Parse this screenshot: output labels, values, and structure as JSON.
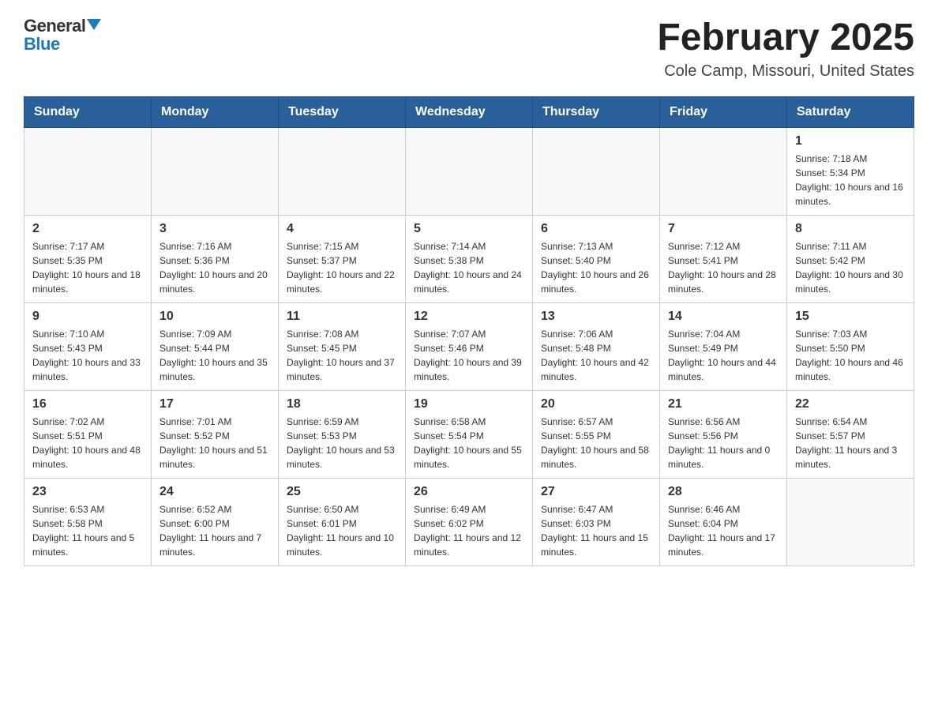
{
  "header": {
    "logo_general": "General",
    "logo_blue": "Blue",
    "month_title": "February 2025",
    "location": "Cole Camp, Missouri, United States"
  },
  "days_of_week": [
    "Sunday",
    "Monday",
    "Tuesday",
    "Wednesday",
    "Thursday",
    "Friday",
    "Saturday"
  ],
  "weeks": [
    [
      {
        "day": "",
        "empty": true
      },
      {
        "day": "",
        "empty": true
      },
      {
        "day": "",
        "empty": true
      },
      {
        "day": "",
        "empty": true
      },
      {
        "day": "",
        "empty": true
      },
      {
        "day": "",
        "empty": true
      },
      {
        "day": "1",
        "sunrise": "Sunrise: 7:18 AM",
        "sunset": "Sunset: 5:34 PM",
        "daylight": "Daylight: 10 hours and 16 minutes."
      }
    ],
    [
      {
        "day": "2",
        "sunrise": "Sunrise: 7:17 AM",
        "sunset": "Sunset: 5:35 PM",
        "daylight": "Daylight: 10 hours and 18 minutes."
      },
      {
        "day": "3",
        "sunrise": "Sunrise: 7:16 AM",
        "sunset": "Sunset: 5:36 PM",
        "daylight": "Daylight: 10 hours and 20 minutes."
      },
      {
        "day": "4",
        "sunrise": "Sunrise: 7:15 AM",
        "sunset": "Sunset: 5:37 PM",
        "daylight": "Daylight: 10 hours and 22 minutes."
      },
      {
        "day": "5",
        "sunrise": "Sunrise: 7:14 AM",
        "sunset": "Sunset: 5:38 PM",
        "daylight": "Daylight: 10 hours and 24 minutes."
      },
      {
        "day": "6",
        "sunrise": "Sunrise: 7:13 AM",
        "sunset": "Sunset: 5:40 PM",
        "daylight": "Daylight: 10 hours and 26 minutes."
      },
      {
        "day": "7",
        "sunrise": "Sunrise: 7:12 AM",
        "sunset": "Sunset: 5:41 PM",
        "daylight": "Daylight: 10 hours and 28 minutes."
      },
      {
        "day": "8",
        "sunrise": "Sunrise: 7:11 AM",
        "sunset": "Sunset: 5:42 PM",
        "daylight": "Daylight: 10 hours and 30 minutes."
      }
    ],
    [
      {
        "day": "9",
        "sunrise": "Sunrise: 7:10 AM",
        "sunset": "Sunset: 5:43 PM",
        "daylight": "Daylight: 10 hours and 33 minutes."
      },
      {
        "day": "10",
        "sunrise": "Sunrise: 7:09 AM",
        "sunset": "Sunset: 5:44 PM",
        "daylight": "Daylight: 10 hours and 35 minutes."
      },
      {
        "day": "11",
        "sunrise": "Sunrise: 7:08 AM",
        "sunset": "Sunset: 5:45 PM",
        "daylight": "Daylight: 10 hours and 37 minutes."
      },
      {
        "day": "12",
        "sunrise": "Sunrise: 7:07 AM",
        "sunset": "Sunset: 5:46 PM",
        "daylight": "Daylight: 10 hours and 39 minutes."
      },
      {
        "day": "13",
        "sunrise": "Sunrise: 7:06 AM",
        "sunset": "Sunset: 5:48 PM",
        "daylight": "Daylight: 10 hours and 42 minutes."
      },
      {
        "day": "14",
        "sunrise": "Sunrise: 7:04 AM",
        "sunset": "Sunset: 5:49 PM",
        "daylight": "Daylight: 10 hours and 44 minutes."
      },
      {
        "day": "15",
        "sunrise": "Sunrise: 7:03 AM",
        "sunset": "Sunset: 5:50 PM",
        "daylight": "Daylight: 10 hours and 46 minutes."
      }
    ],
    [
      {
        "day": "16",
        "sunrise": "Sunrise: 7:02 AM",
        "sunset": "Sunset: 5:51 PM",
        "daylight": "Daylight: 10 hours and 48 minutes."
      },
      {
        "day": "17",
        "sunrise": "Sunrise: 7:01 AM",
        "sunset": "Sunset: 5:52 PM",
        "daylight": "Daylight: 10 hours and 51 minutes."
      },
      {
        "day": "18",
        "sunrise": "Sunrise: 6:59 AM",
        "sunset": "Sunset: 5:53 PM",
        "daylight": "Daylight: 10 hours and 53 minutes."
      },
      {
        "day": "19",
        "sunrise": "Sunrise: 6:58 AM",
        "sunset": "Sunset: 5:54 PM",
        "daylight": "Daylight: 10 hours and 55 minutes."
      },
      {
        "day": "20",
        "sunrise": "Sunrise: 6:57 AM",
        "sunset": "Sunset: 5:55 PM",
        "daylight": "Daylight: 10 hours and 58 minutes."
      },
      {
        "day": "21",
        "sunrise": "Sunrise: 6:56 AM",
        "sunset": "Sunset: 5:56 PM",
        "daylight": "Daylight: 11 hours and 0 minutes."
      },
      {
        "day": "22",
        "sunrise": "Sunrise: 6:54 AM",
        "sunset": "Sunset: 5:57 PM",
        "daylight": "Daylight: 11 hours and 3 minutes."
      }
    ],
    [
      {
        "day": "23",
        "sunrise": "Sunrise: 6:53 AM",
        "sunset": "Sunset: 5:58 PM",
        "daylight": "Daylight: 11 hours and 5 minutes."
      },
      {
        "day": "24",
        "sunrise": "Sunrise: 6:52 AM",
        "sunset": "Sunset: 6:00 PM",
        "daylight": "Daylight: 11 hours and 7 minutes."
      },
      {
        "day": "25",
        "sunrise": "Sunrise: 6:50 AM",
        "sunset": "Sunset: 6:01 PM",
        "daylight": "Daylight: 11 hours and 10 minutes."
      },
      {
        "day": "26",
        "sunrise": "Sunrise: 6:49 AM",
        "sunset": "Sunset: 6:02 PM",
        "daylight": "Daylight: 11 hours and 12 minutes."
      },
      {
        "day": "27",
        "sunrise": "Sunrise: 6:47 AM",
        "sunset": "Sunset: 6:03 PM",
        "daylight": "Daylight: 11 hours and 15 minutes."
      },
      {
        "day": "28",
        "sunrise": "Sunrise: 6:46 AM",
        "sunset": "Sunset: 6:04 PM",
        "daylight": "Daylight: 11 hours and 17 minutes."
      },
      {
        "day": "",
        "empty": true
      }
    ]
  ]
}
